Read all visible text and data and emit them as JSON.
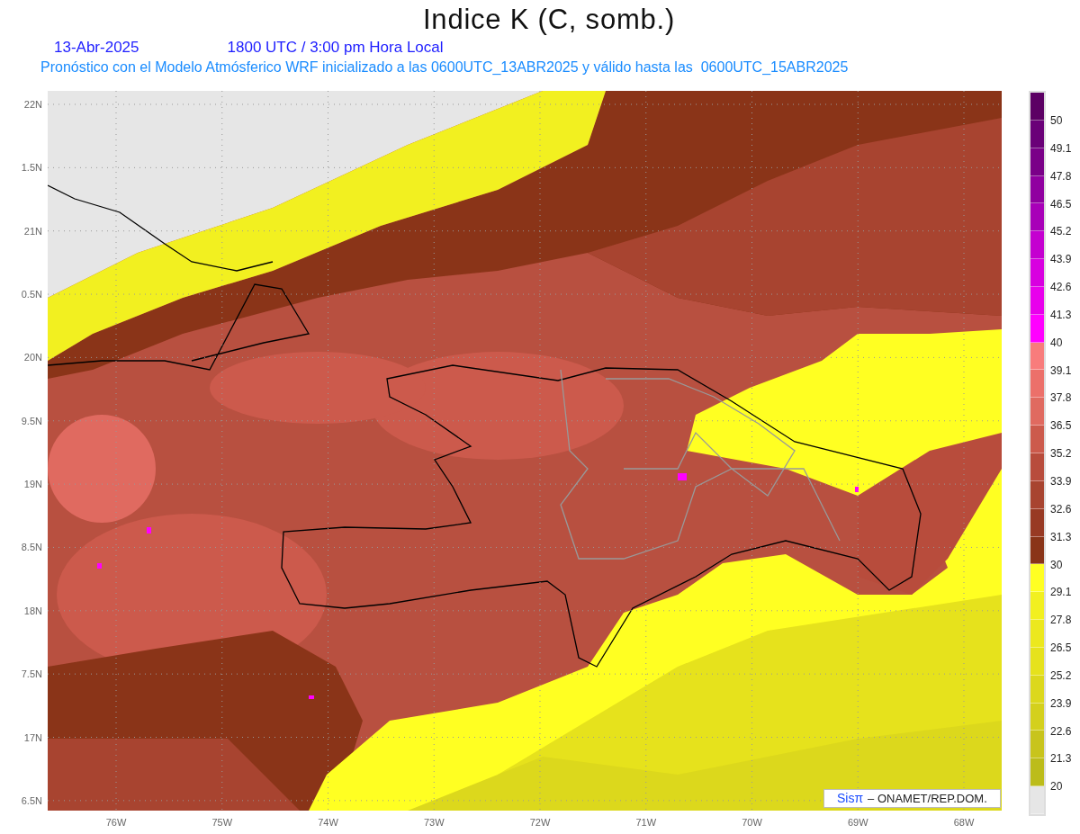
{
  "title": "Indice K (C, somb.)",
  "date": "13-Abr-2025",
  "time": "1800 UTC / 3:00 pm Hora Local",
  "description": "Pronóstico con el Modelo Atmósferico WRF inicializado a las 0600UTC_13ABR2025 y válido hasta las  0600UTC_15ABR2025",
  "lat_labels": [
    "22N",
    "1.5N",
    "21N",
    "0.5N",
    "20N",
    "9.5N",
    "19N",
    "8.5N",
    "18N",
    "7.5N",
    "17N",
    "6.5N"
  ],
  "lon_labels": [
    "76W",
    "75W",
    "74W",
    "73W",
    "72W",
    "71W",
    "70W",
    "69W",
    "68W"
  ],
  "colorbar": {
    "bins": [
      {
        "color": "#5c0064"
      },
      {
        "color": "#6a0078"
      },
      {
        "color": "#7a0088"
      },
      {
        "color": "#9000a0"
      },
      {
        "color": "#a800b8"
      },
      {
        "color": "#c400d0"
      },
      {
        "color": "#d800e0"
      },
      {
        "color": "#e800ec"
      },
      {
        "color": "#ff00ff"
      },
      {
        "color": "#f87c7c"
      },
      {
        "color": "#ec706a"
      },
      {
        "color": "#e06a60"
      },
      {
        "color": "#cc5a4c"
      },
      {
        "color": "#b84c3c"
      },
      {
        "color": "#a84430"
      },
      {
        "color": "#983a24"
      },
      {
        "color": "#8a3418"
      },
      {
        "color": "#ffff22"
      },
      {
        "color": "#f2f020"
      },
      {
        "color": "#ece81e"
      },
      {
        "color": "#e6e21c"
      },
      {
        "color": "#dcd81c"
      },
      {
        "color": "#d4d01c"
      },
      {
        "color": "#c8c41c"
      },
      {
        "color": "#bcbc1a"
      },
      {
        "color": "#e6e6e6"
      }
    ],
    "labels": [
      "50",
      "49.1",
      "47.8",
      "46.5",
      "45.2",
      "43.9",
      "42.6",
      "41.3",
      "40",
      "39.1",
      "37.8",
      "36.5",
      "35.2",
      "33.9",
      "32.6",
      "31.3",
      "30",
      "29.1",
      "27.8",
      "26.5",
      "25.2",
      "23.9",
      "22.6",
      "21.3",
      "20"
    ]
  },
  "credit": {
    "brand": "Sisπ",
    "text": "– ONAMET/REP.DOM."
  }
}
